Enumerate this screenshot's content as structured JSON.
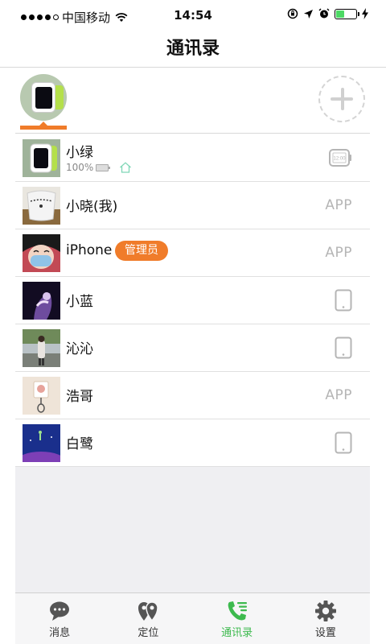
{
  "status_bar": {
    "carrier": "中国移动",
    "time": "14:54"
  },
  "nav": {
    "title": "通讯录"
  },
  "device_strip": {
    "selected_device": "小绿",
    "add_icon": "plus-circle-icon"
  },
  "contacts": [
    {
      "name": "小绿",
      "battery": "100%",
      "type_icon": "watch-icon",
      "extra_icon": "home-icon"
    },
    {
      "name": "小晓(我)",
      "type_label": "APP"
    },
    {
      "name": "iPhone",
      "badge": "管理员",
      "type_label": "APP"
    },
    {
      "name": "小蓝",
      "type_icon": "tablet-icon"
    },
    {
      "name": "沁沁",
      "type_icon": "tablet-icon"
    },
    {
      "name": "浩哥",
      "type_label": "APP"
    },
    {
      "name": "白鹭",
      "type_icon": "tablet-icon"
    }
  ],
  "tabbar": {
    "tabs": [
      {
        "label": "消息",
        "icon": "chat-bubble-icon"
      },
      {
        "label": "定位",
        "icon": "location-pins-icon"
      },
      {
        "label": "通讯录",
        "icon": "phone-contacts-icon",
        "active": true
      },
      {
        "label": "设置",
        "icon": "gear-icon"
      }
    ]
  },
  "colors": {
    "accent_orange": "#f07c2a",
    "active_green": "#3dba4e",
    "battery_green": "#4cd964"
  }
}
